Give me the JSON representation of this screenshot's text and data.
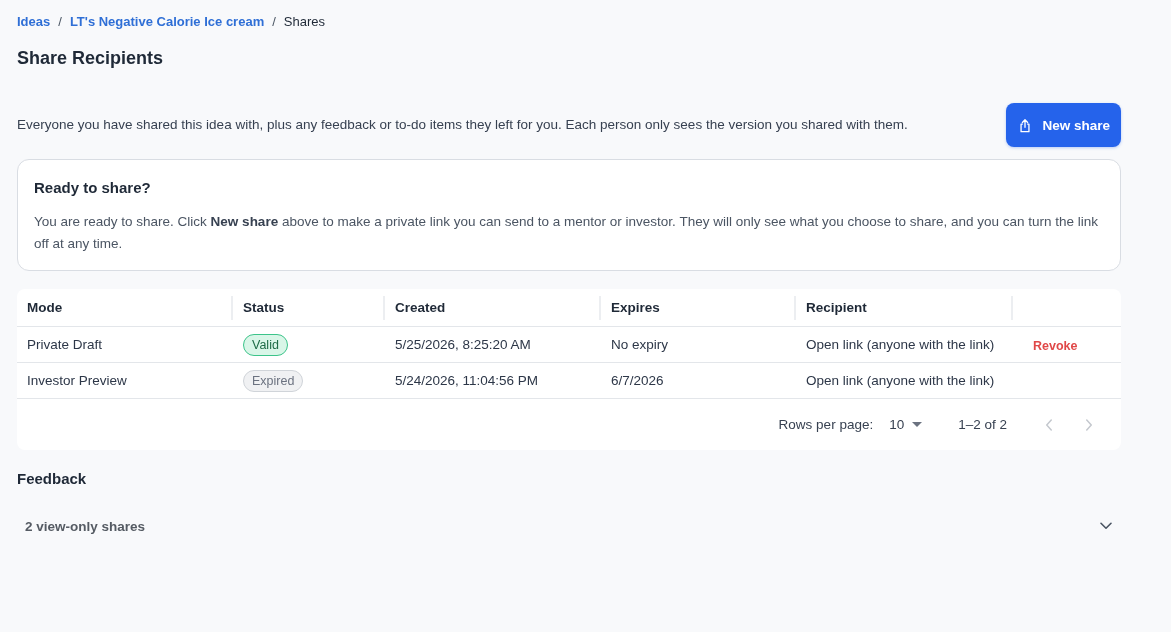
{
  "breadcrumb": [
    {
      "label": "Ideas",
      "kind": "link"
    },
    {
      "label": "/",
      "kind": "separator"
    },
    {
      "label": "LT's Negative Calorie Ice cream",
      "kind": "link"
    },
    {
      "label": "/",
      "kind": "separator"
    },
    {
      "label": "Shares",
      "kind": "current"
    }
  ],
  "title": "Share Recipients",
  "description": "Everyone you have shared this idea with, plus any feedback or to-do items they left for you. Each person only sees the version you shared with them.",
  "new_share_button": {
    "label": "New share"
  },
  "ready_card": {
    "title": "Ready to share?",
    "body": "You are ready to share. Click **New share** above to make a private link you can send to a mentor or investor. They will only see what you choose to share, and you can turn the link off at any time."
  },
  "table": {
    "columns": [
      "Mode",
      "Status",
      "Created",
      "Expires",
      "Recipient"
    ],
    "rows": [
      {
        "mode": "Private Draft",
        "status": {
          "label": "Valid",
          "kind": "valid"
        },
        "created": "5/25/2026, 8:25:20 AM",
        "expires": "No expiry",
        "recipient": "Open link (anyone with the link)",
        "action": "Revoke"
      },
      {
        "mode": "Investor Preview",
        "status": {
          "label": "Expired",
          "kind": "expired"
        },
        "created": "5/24/2026, 11:04:56 PM",
        "expires": "6/7/2026",
        "recipient": "Open link (anyone with the link)"
      }
    ],
    "pagination": {
      "rows_per_page_label": "Rows per page:",
      "rows_per_page": "10",
      "range": "1–2 of 2",
      "previous": {
        "disabled": true
      },
      "next": {
        "disabled": true
      }
    }
  },
  "feedback": {
    "title": "Feedback",
    "accordion": {
      "label": "2 view-only shares",
      "expanded": false
    }
  }
}
